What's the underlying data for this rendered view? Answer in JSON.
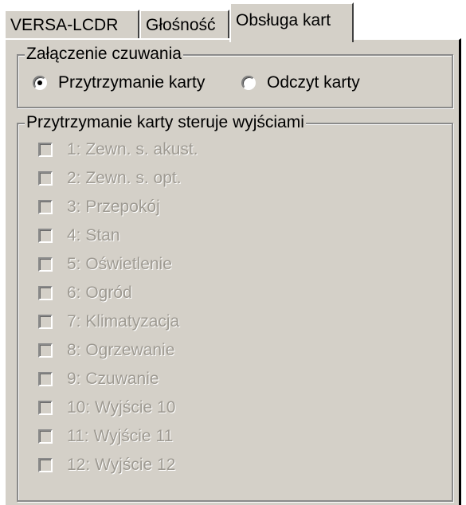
{
  "tabs": [
    {
      "label": "VERSA-LCDR",
      "active": false
    },
    {
      "label": "Głośność",
      "active": false
    },
    {
      "label": "Obsługa kart",
      "active": true
    }
  ],
  "arming_group": {
    "title": "Załączenie czuwania",
    "options": [
      {
        "label": "Przytrzymanie karty",
        "selected": true
      },
      {
        "label": "Odczyt karty",
        "selected": false
      }
    ]
  },
  "outputs_group": {
    "title": "Przytrzymanie karty steruje wyjściami",
    "enabled": false,
    "items": [
      {
        "label": "1: Zewn. s. akust.",
        "checked": false
      },
      {
        "label": "2: Zewn. s. opt.",
        "checked": false
      },
      {
        "label": "3: Przepokój",
        "checked": false
      },
      {
        "label": "4: Stan",
        "checked": false
      },
      {
        "label": "5: Oświetlenie",
        "checked": false
      },
      {
        "label": "6: Ogród",
        "checked": false
      },
      {
        "label": "7: Klimatyzacja",
        "checked": false
      },
      {
        "label": "8: Ogrzewanie",
        "checked": false
      },
      {
        "label": "9: Czuwanie",
        "checked": false
      },
      {
        "label": "10: Wyjście 10",
        "checked": false
      },
      {
        "label": "11: Wyjście 11",
        "checked": false
      },
      {
        "label": "12: Wyjście 12",
        "checked": false
      }
    ]
  },
  "colors": {
    "face": "#d4d0c8",
    "disabled_text": "#9e9a92",
    "shadow": "#8a8a8a"
  }
}
